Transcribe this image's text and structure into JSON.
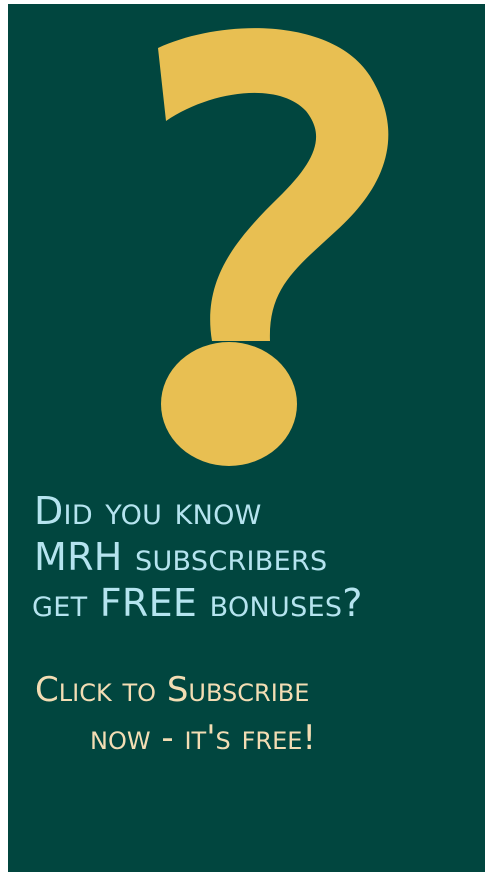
{
  "colors": {
    "background": "#01463f",
    "question_mark": "#e8bf52",
    "headline_text": "#b5e4ef",
    "cta_text": "#f3ddb4"
  },
  "graphic": {
    "icon": "question-mark-icon"
  },
  "headline": {
    "line1": "Did you know",
    "line2": "MRH subscribers",
    "line3": "get FREE bonuses?"
  },
  "cta": {
    "line1": "Click to Subscribe",
    "line2": "now - it's free!"
  }
}
